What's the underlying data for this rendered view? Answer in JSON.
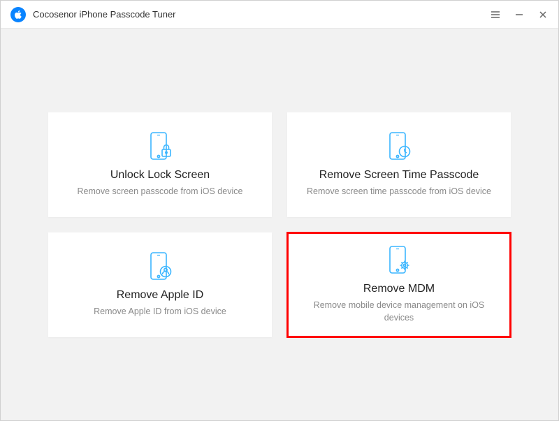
{
  "window": {
    "title": "Cocosenor iPhone Passcode Tuner"
  },
  "cards": [
    {
      "title": "Unlock Lock Screen",
      "description": "Remove screen passcode from iOS device",
      "highlighted": false
    },
    {
      "title": "Remove Screen Time Passcode",
      "description": "Remove screen time passcode from iOS device",
      "highlighted": false
    },
    {
      "title": "Remove Apple ID",
      "description": "Remove Apple ID from iOS device",
      "highlighted": false
    },
    {
      "title": "Remove MDM",
      "description": "Remove mobile device management on iOS devices",
      "highlighted": true
    }
  ],
  "colors": {
    "accent": "#0a84ff",
    "icon": "#3cb6ff",
    "highlight": "#ff0000"
  }
}
